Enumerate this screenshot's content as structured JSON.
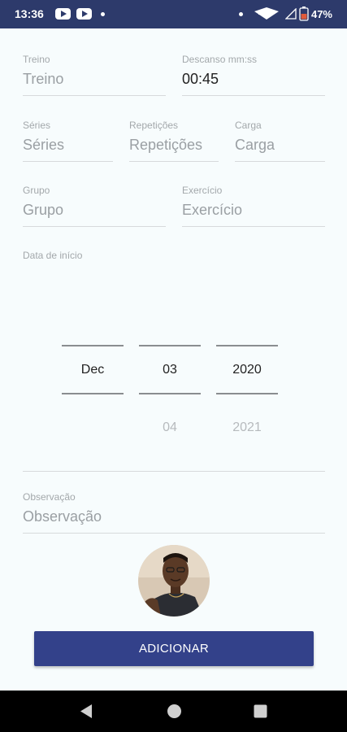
{
  "status_bar": {
    "time": "13:36",
    "battery": "47%",
    "icons": [
      "youtube-icon",
      "youtube-icon",
      "notification-dot-icon",
      "wifi-icon",
      "signal-icon",
      "battery-icon"
    ]
  },
  "form": {
    "treino": {
      "label": "Treino",
      "placeholder": "Treino",
      "value": ""
    },
    "descanso": {
      "label": "Descanso mm:ss",
      "value": "00:45"
    },
    "series": {
      "label": "Séries",
      "placeholder": "Séries",
      "value": ""
    },
    "repeticoes": {
      "label": "Repetições",
      "placeholder": "Repetições",
      "value": ""
    },
    "carga": {
      "label": "Carga",
      "placeholder": "Carga",
      "value": ""
    },
    "grupo": {
      "label": "Grupo",
      "placeholder": "Grupo",
      "value": ""
    },
    "exercicio": {
      "label": "Exercício",
      "placeholder": "Exercício",
      "value": ""
    },
    "data_inicio": {
      "label": "Data de início",
      "month": {
        "selected": "Dec",
        "next": ""
      },
      "day": {
        "selected": "03",
        "next": "04"
      },
      "year": {
        "selected": "2020",
        "next": "2021"
      }
    },
    "observacao": {
      "label": "Observação",
      "placeholder": "Observação",
      "value": ""
    }
  },
  "add_button": {
    "label": "ADICIONAR"
  },
  "nav": {
    "icons": [
      "back-icon",
      "home-icon",
      "recents-icon"
    ]
  },
  "colors": {
    "status_bar": "#2d3a6b",
    "button": "#33418a",
    "background": "#f7fcfd"
  }
}
